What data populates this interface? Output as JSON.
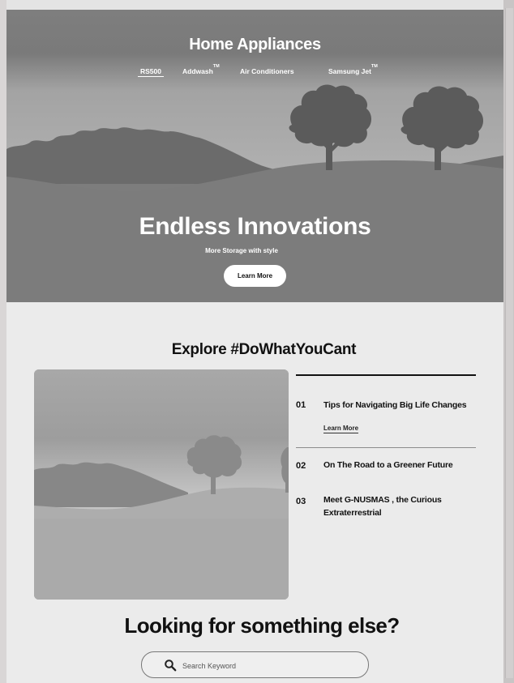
{
  "hero": {
    "title": "Home Appliances",
    "tabs": [
      {
        "label": "RS500",
        "tm": "",
        "active": true
      },
      {
        "label": "Addwash",
        "tm": "TM",
        "active": false
      },
      {
        "label": "Air Conditioners",
        "tm": "",
        "active": false
      },
      {
        "label": "Samsung Jet",
        "tm": "TM",
        "active": false
      }
    ],
    "headline": "Endless Innovations",
    "subtitle": "More Storage with style",
    "cta_label": "Learn More"
  },
  "explore": {
    "title": "Explore #DoWhatYouCant",
    "items": [
      {
        "num": "01",
        "title": "Tips for Navigating Big Life Changes",
        "link": "Learn More"
      },
      {
        "num": "02",
        "title": "On The Road to a Greener Future"
      },
      {
        "num": "03",
        "title": "Meet G-NUSMAS , the Curious Extraterrestrial"
      }
    ]
  },
  "search": {
    "title": "Looking for something else?",
    "placeholder": "Search Keyword",
    "icon": "search-icon"
  }
}
